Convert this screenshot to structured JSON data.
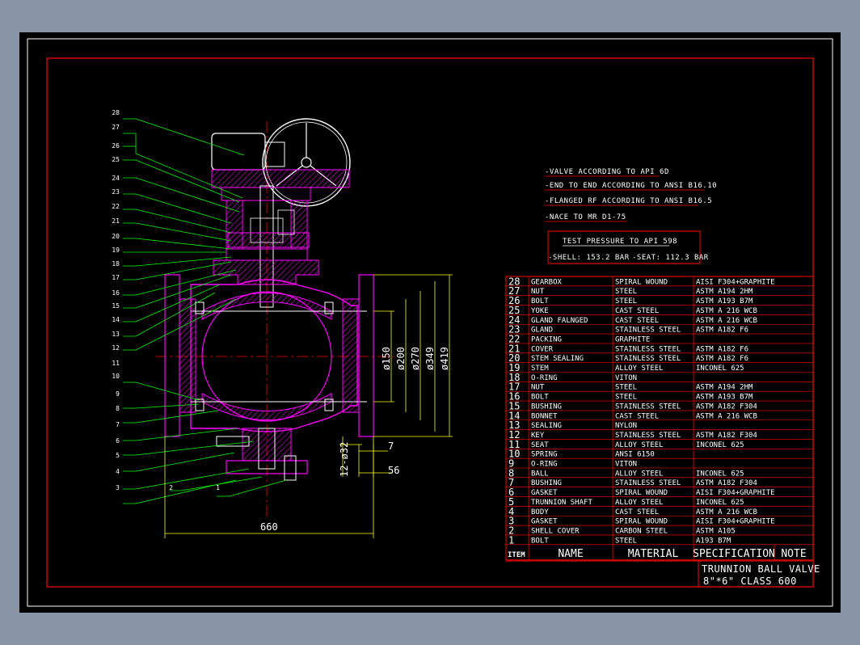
{
  "notes": [
    "-VALVE ACCORDING TO API 6D",
    "-END TO END ACCORDING TO ANSI B16.10",
    "-FLANGED RF ACCORDING TO ANSI B16.5",
    "-NACE TO MR D1-75"
  ],
  "test_pressure": {
    "title": "TEST PRESSURE TO API 598",
    "shell": "-SHELL: 153.2 BAR",
    "seat": "-SEAT: 112.3 BAR"
  },
  "parts": [
    {
      "item": "28",
      "name": "GEARBOX",
      "material": "SPIRAL WOUND",
      "spec": "AISI F304+GRAPHITE"
    },
    {
      "item": "27",
      "name": "NUT",
      "material": "STEEL",
      "spec": "ASTM A194 2HM"
    },
    {
      "item": "26",
      "name": "BOLT",
      "material": "STEEL",
      "spec": "ASTM A193 B7M"
    },
    {
      "item": "25",
      "name": "YOKE",
      "material": "CAST STEEL",
      "spec": "ASTM A 216 WCB"
    },
    {
      "item": "24",
      "name": "GLAND FALNGED",
      "material": "CAST STEEL",
      "spec": "ASTM A 216 WCB"
    },
    {
      "item": "23",
      "name": "GLAND",
      "material": "STAINLESS STEEL",
      "spec": "ASTM A182 F6"
    },
    {
      "item": "22",
      "name": "PACKING",
      "material": "GRAPHITE",
      "spec": ""
    },
    {
      "item": "21",
      "name": "COVER",
      "material": "STAINLESS STEEL",
      "spec": "ASTM A182 F6"
    },
    {
      "item": "20",
      "name": "STEM SEALING",
      "material": "STAINLESS STEEL",
      "spec": "ASTM A182 F6"
    },
    {
      "item": "19",
      "name": "STEM",
      "material": "ALLOY STEEL",
      "spec": "INCONEL 625"
    },
    {
      "item": "18",
      "name": "O-RING",
      "material": "VITON",
      "spec": ""
    },
    {
      "item": "17",
      "name": "NUT",
      "material": "STEEL",
      "spec": "ASTM A194 2HM"
    },
    {
      "item": "16",
      "name": "BOLT",
      "material": "STEEL",
      "spec": "ASTM A193 B7M"
    },
    {
      "item": "15",
      "name": "BUSHING",
      "material": "STAINLESS STEEL",
      "spec": "ASTM A182 F304"
    },
    {
      "item": "14",
      "name": "BONNET",
      "material": "CAST STEEL",
      "spec": "ASTM A 216 WCB"
    },
    {
      "item": "13",
      "name": "SEALING",
      "material": "NYLON",
      "spec": ""
    },
    {
      "item": "12",
      "name": "KEY",
      "material": "STAINLESS STEEL",
      "spec": "ASTM A182 F304"
    },
    {
      "item": "11",
      "name": "SEAT",
      "material": "ALLOY STEEL",
      "spec": "INCONEL 625"
    },
    {
      "item": "10",
      "name": "SPRING",
      "material": "ANSI 6150",
      "spec": ""
    },
    {
      "item": "9",
      "name": "O-RING",
      "material": "VITON",
      "spec": ""
    },
    {
      "item": "8",
      "name": "BALL",
      "material": "ALLOY STEEL",
      "spec": "INCONEL 625"
    },
    {
      "item": "7",
      "name": "BUSHING",
      "material": "STAINLESS STEEL",
      "spec": "ASTM A182 F304"
    },
    {
      "item": "6",
      "name": "GASKET",
      "material": "SPIRAL WOUND",
      "spec": "AISI F304+GRAPHITE"
    },
    {
      "item": "5",
      "name": "TRUNNION SHAFT",
      "material": "ALLOY STEEL",
      "spec": "INCONEL 625"
    },
    {
      "item": "4",
      "name": "BODY",
      "material": "CAST STEEL",
      "spec": "ASTM A 216 WCB"
    },
    {
      "item": "3",
      "name": "GASKET",
      "material": "SPIRAL WOUND",
      "spec": "AISI F304+GRAPHITE"
    },
    {
      "item": "2",
      "name": "SHELL COVER",
      "material": "CARBON STEEL",
      "spec": "ASTM A105"
    },
    {
      "item": "1",
      "name": "BOLT",
      "material": "STEEL",
      "spec": "A193 B7M"
    }
  ],
  "table_header": {
    "item": "ITEM",
    "name": "NAME",
    "material": "MATERIAL",
    "spec": "SPECIFICATION",
    "note": "NOTE"
  },
  "title_block": {
    "line1": "TRUNNION BALL VALVE",
    "line2": "8\"*6\" CLASS 600"
  },
  "dimensions": {
    "overall_length": "660",
    "d150": "ø150",
    "d200": "ø200",
    "d270": "ø270",
    "d349": "ø349",
    "d419": "ø419",
    "bolt_holes": "12-ø32",
    "dim_7": "7",
    "dim_56": "56"
  },
  "balloons": [
    "28",
    "27",
    "26",
    "25",
    "24",
    "23",
    "22",
    "21",
    "20",
    "19",
    "18",
    "17",
    "16",
    "15",
    "14",
    "13",
    "12",
    "11",
    "10",
    "9",
    "8",
    "7",
    "6",
    "5",
    "4",
    "3",
    "2",
    "1"
  ],
  "colors": {
    "background": "#000000",
    "border": "#ff0000",
    "frame": "#ffffff",
    "leader": "#00ff00",
    "dimension": "#ffff00",
    "hatch": "#ff00ff",
    "body": "#ff00ff",
    "gear": "#ffffff",
    "centerline": "#ff0000"
  }
}
